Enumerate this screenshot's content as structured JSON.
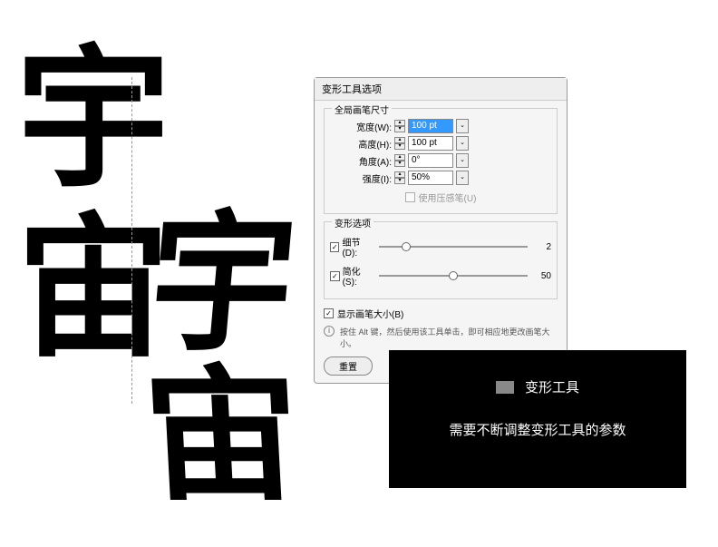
{
  "calligraphy": {
    "char1": "宇",
    "char2": "宙",
    "char3": "宇",
    "char4": "宙"
  },
  "dialog": {
    "title": "变形工具选项",
    "brush_group": "全局画笔尺寸",
    "width_label": "宽度(W):",
    "width_value": "100 pt",
    "height_label": "高度(H):",
    "height_value": "100 pt",
    "angle_label": "角度(A):",
    "angle_value": "0°",
    "intensity_label": "强度(I):",
    "intensity_value": "50%",
    "pressure_label": "使用压感笔(U)",
    "warp_group": "变形选项",
    "detail_label": "细节(D):",
    "detail_value": "2",
    "simplify_label": "简化(S):",
    "simplify_value": "50",
    "show_brush_label": "显示画笔大小(B)",
    "info_text": "按住 Alt 键，然后使用该工具单击，即可相应地更改画笔大小。",
    "reset_btn": "重置"
  },
  "blackbox": {
    "title": "变形工具",
    "text": "需要不断调整变形工具的参数"
  }
}
